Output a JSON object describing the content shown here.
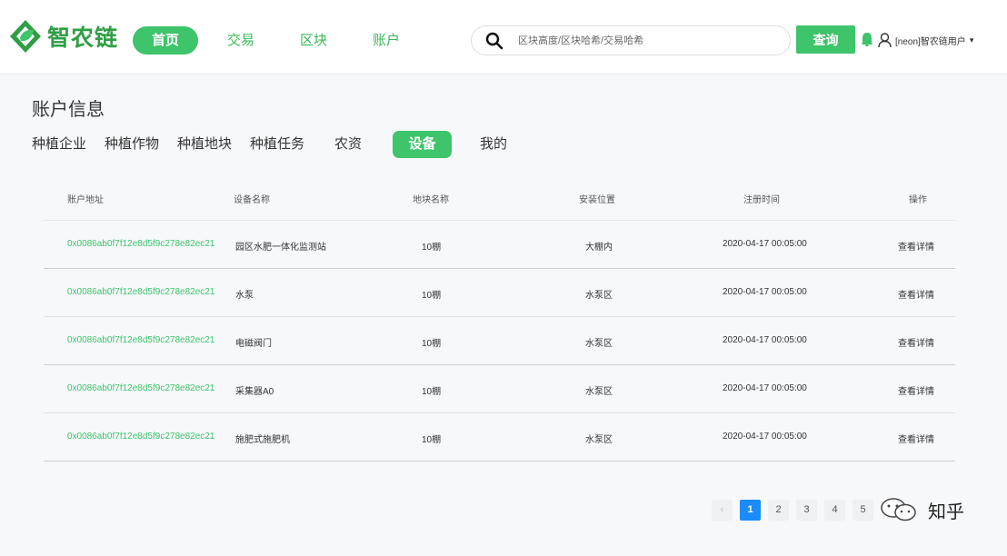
{
  "header": {
    "logo_text": "智农链",
    "nav": [
      "首页",
      "交易",
      "区块",
      "账户"
    ],
    "search_placeholder": "区块高度/区块哈希/交易哈希",
    "query_label": "查询",
    "user_text": "[neon]智农链用户",
    "user_chevron": "▾"
  },
  "page": {
    "title": "账户信息",
    "tabs": [
      "种植企业",
      "种植作物",
      "种植地块",
      "种植任务",
      "农资",
      "设备",
      "我的"
    ],
    "active_tab": "设备"
  },
  "table": {
    "columns": [
      "账户地址",
      "设备名称",
      "地块名称",
      "安装位置",
      "注册时间",
      "操作"
    ],
    "rows": [
      [
        "0x0086ab0f7f12e8d5f9c278e82ec21",
        "园区水肥一体化监测站",
        "10棚",
        "大棚内",
        "2020-04-17 00:05:00",
        "查看详情"
      ],
      [
        "0x0086ab0f7f12e8d5f9c278e82ec21",
        "水泵",
        "10棚",
        "水泵区",
        "2020-04-17 00:05:00",
        "查看详情"
      ],
      [
        "0x0086ab0f7f12e8d5f9c278e82ec21",
        "电磁阀门",
        "10棚",
        "水泵区",
        "2020-04-17 00:05:00",
        "查看详情"
      ],
      [
        "0x0086ab0f7f12e8d5f9c278e82ec21",
        "采集器A0",
        "10棚",
        "水泵区",
        "2020-04-17 00:05:00",
        "查看详情"
      ],
      [
        "0x0086ab0f7f12e8d5f9c278e82ec21",
        "施肥式施肥机",
        "10棚",
        "水泵区",
        "2020-04-17 00:05:00",
        "查看详情"
      ]
    ]
  },
  "pagination": {
    "prev": "‹",
    "pages": [
      "1",
      "2",
      "3",
      "4",
      "5"
    ],
    "current": "1"
  },
  "watermark": {
    "text": "知乎"
  },
  "colors": {
    "accent": "#3ec46a",
    "page_active": "#1a8cff"
  },
  "icons": {
    "logo": "leaf-logo-icon",
    "search": "search-icon",
    "bell": "bell-icon",
    "user": "user-icon",
    "watermark": "wechat-icon"
  }
}
